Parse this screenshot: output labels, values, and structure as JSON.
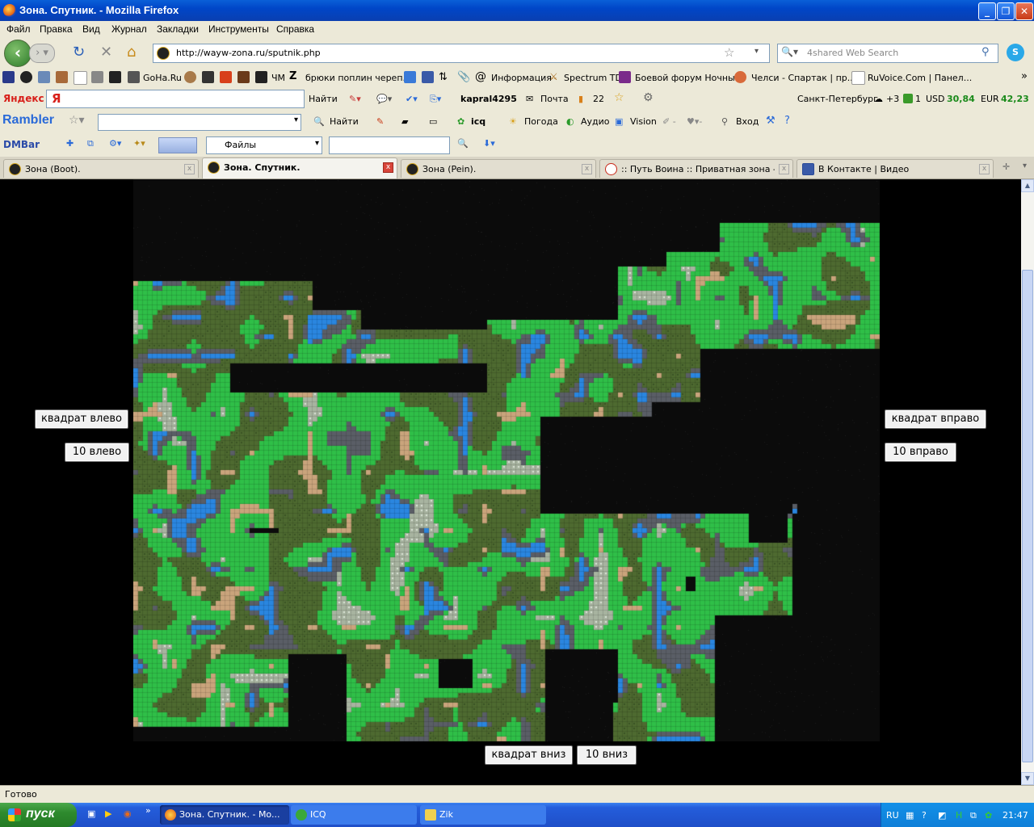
{
  "window": {
    "title": "Зона. Спутник. - Mozilla Firefox"
  },
  "menu": [
    "Файл",
    "Правка",
    "Вид",
    "Журнал",
    "Закладки",
    "Инструменты",
    "Справка"
  ],
  "nav": {
    "url": "http://wayw-zona.ru/sputnik.php",
    "search_placeholder": "4shared Web Search"
  },
  "bookmarks": [
    "GoHa.Ru",
    "ЧМ",
    "брюки поплин череп...",
    "Информация",
    "Spectrum TD",
    "Боевой форум Ночны...",
    "Челси - Спартак | пр...",
    "RuVoice.Com | Панел..."
  ],
  "yandex": {
    "logo": "Яндекс",
    "find": "Найти",
    "user": "kapral4295",
    "mail": "Почта",
    "count": "22",
    "city": "Санкт-Петербург",
    "weather": "+3",
    "usd_label": "USD",
    "usd": "30,84",
    "eur_label": "EUR",
    "eur": "42,23",
    "msg_count": "1"
  },
  "rambler": {
    "logo": "Rambler",
    "find": "Найти",
    "icq": "icq",
    "weather": "Погода",
    "audio": "Аудио",
    "vision": "Vision",
    "login": "Вход"
  },
  "dmbar": {
    "logo": "DMBar",
    "select": "Файлы"
  },
  "tabs": [
    {
      "label": "Зона (Boot).",
      "active": false
    },
    {
      "label": "Зона. Спутник.",
      "active": true
    },
    {
      "label": "Зона (Pein).",
      "active": false
    },
    {
      "label": ":: Путь Воина :: Приватная зона - N...",
      "active": false
    },
    {
      "label": "В Контакте | Видео",
      "active": false
    }
  ],
  "page": {
    "btn_left_square": "квадрат влево",
    "btn_left_10": "10 влево",
    "btn_right_square": "квадрат вправо",
    "btn_right_10": "10 вправо",
    "btn_down_square": "квадрат вниз",
    "btn_down_10": "10 вниз"
  },
  "map_colors": {
    "void": "#0b0b0b",
    "grass": "#2fbf48",
    "forest": "#4e6a30",
    "rock": "#5a5e66",
    "water": "#2a86e0",
    "sand": "#caa47c",
    "snow": "#a8b4a0"
  },
  "status": "Готово",
  "taskbar": {
    "start": "пуск",
    "tasks": [
      "Зона. Спутник. - Mo...",
      "ICQ",
      "Zik"
    ],
    "lang": "RU",
    "time": "21:47"
  }
}
